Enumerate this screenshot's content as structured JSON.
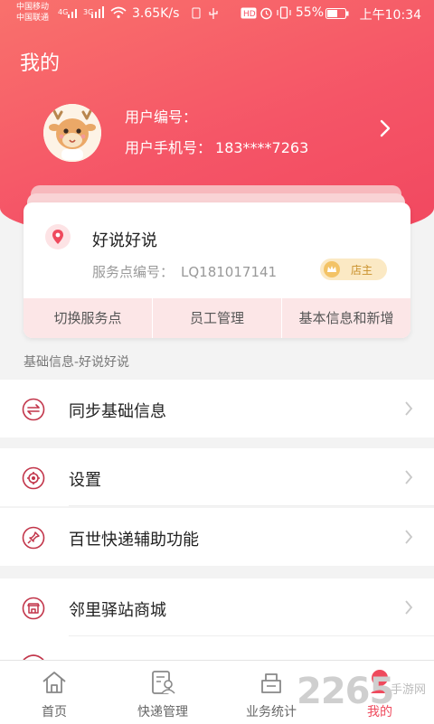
{
  "status_bar": {
    "carrier1": "中国移动",
    "carrier2": "中国联通",
    "net1": "4G",
    "net2": "3G",
    "speed": "3.65K/s",
    "battery": "55%",
    "time": "上午10:34"
  },
  "page_title": "我的",
  "user": {
    "id_label": "用户编号：",
    "phone_label": "用户手机号：",
    "phone": "183****7263"
  },
  "shop": {
    "name": "好说好说",
    "service_label": "服务点编号：",
    "service_code": "LQ181017141",
    "role_badge": "店主",
    "actions": [
      "切换服务点",
      "员工管理",
      "基本信息和新增"
    ]
  },
  "section_label": "基础信息-好说好说",
  "menu": {
    "sync": "同步基础信息",
    "settings": "设置",
    "assist": "百世快递辅助功能",
    "mall": "邻里驿站商城"
  },
  "nav": {
    "home": "首页",
    "express": "快递管理",
    "stats": "业务统计",
    "mine": "我的"
  },
  "watermark": {
    "brand": "2265",
    "suffix": "手游网"
  },
  "colors": {
    "accent": "#ef4a5d",
    "header_start": "#f9716c",
    "header_end": "#f1475f"
  }
}
